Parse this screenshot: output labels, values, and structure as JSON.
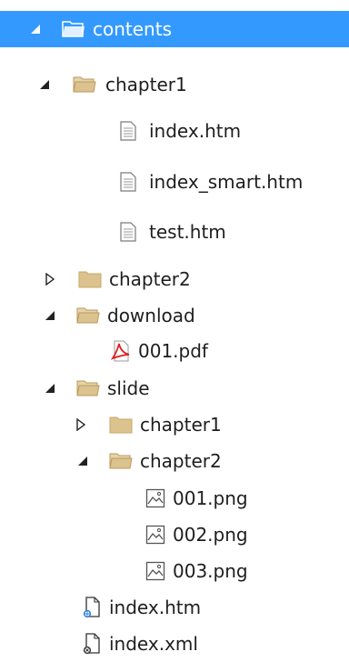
{
  "tree": {
    "root": {
      "label": "contents"
    },
    "chapter1": {
      "label": "chapter1",
      "files": [
        {
          "label": "index.htm"
        },
        {
          "label": "index_smart.htm"
        },
        {
          "label": "test.htm"
        }
      ]
    },
    "chapter2": {
      "label": "chapter2"
    },
    "download": {
      "label": "download",
      "files": [
        {
          "label": "001.pdf"
        }
      ]
    },
    "slide": {
      "label": "slide",
      "chapter1": {
        "label": "chapter1"
      },
      "chapter2": {
        "label": "chapter2",
        "files": [
          {
            "label": "001.png"
          },
          {
            "label": "002.png"
          },
          {
            "label": "003.png"
          }
        ]
      }
    },
    "root_files": [
      {
        "label": "index.htm"
      },
      {
        "label": "index.xml"
      }
    ]
  },
  "colors": {
    "selection": "#3399ff",
    "folder": "#dcc28f",
    "pdf": "#e02020"
  }
}
